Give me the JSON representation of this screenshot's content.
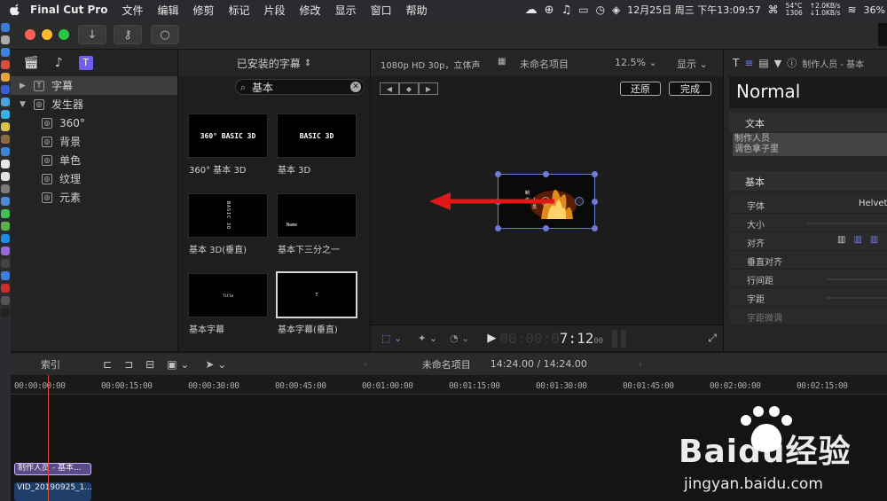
{
  "menubar": {
    "app": "Final Cut Pro",
    "menus": [
      "文件",
      "编辑",
      "修剪",
      "标记",
      "片段",
      "修改",
      "显示",
      "窗口",
      "帮助"
    ],
    "status": {
      "temp": "54°C",
      "fan": "1306",
      "up": "↑2.0KB/s",
      "down": "↓1.0KB/s",
      "datetime": "12月25日 周三 下午13:09:57",
      "battery": "36%"
    }
  },
  "library": {
    "items": [
      {
        "label": "字幕",
        "expanded": false,
        "selected": true
      },
      {
        "label": "发生器",
        "expanded": true,
        "selected": false
      }
    ],
    "generators": [
      "360°",
      "背景",
      "单色",
      "纹理",
      "元素"
    ]
  },
  "browser": {
    "header": "已安装的字幕",
    "search_value": "基本",
    "tiles": [
      {
        "thumb": "360° BASIC 3D",
        "caption": "360° 基本 3D"
      },
      {
        "thumb": "BASIC 3D",
        "caption": "基本 3D"
      },
      {
        "thumb": "BASIC 3D",
        "caption": "基本 3D(垂直)"
      },
      {
        "thumb": "Name",
        "caption": "基本下三分之一"
      },
      {
        "thumb": "Title",
        "caption": "基本字幕"
      },
      {
        "thumb": "T",
        "caption": "基本字幕(垂直)"
      }
    ]
  },
  "viewer": {
    "format": "1080p HD 30p，立体声",
    "project": "未命名项目",
    "zoom": "12.5%",
    "display_menu": "显示",
    "reset_button": "还原",
    "done_button": "完成",
    "timecode_dim": "00:00:0",
    "timecode_main": "7:12",
    "timecode_frames": "00"
  },
  "inspector": {
    "title": "制作人员 - 基本",
    "style_name": "Normal",
    "sections": {
      "text": "文本",
      "basic": "基本"
    },
    "text_value_line1": "制作人员",
    "text_value_line2": "调色拿子里",
    "params": [
      "字体",
      "大小",
      "对齐",
      "垂直对齐",
      "行间距",
      "字距",
      "字距微调"
    ],
    "font_value": "Helvet"
  },
  "timeline": {
    "index_label": "索引",
    "project": "未命名项目",
    "duration": "14:24.00 / 14:24.00",
    "ticks": [
      "00:00:00:00",
      "00:00:15:00",
      "00:00:30:00",
      "00:00:45:00",
      "00:01:00:00",
      "00:01:15:00",
      "00:01:30:00",
      "00:01:45:00",
      "00:02:00:00",
      "00:02:15:00"
    ],
    "title_clip": "制作人员 - 基本...",
    "video_clip": "VID_20190925_1..."
  },
  "watermark": {
    "brand": "Baidu经验",
    "url": "jingyan.baidu.com"
  },
  "colors": {
    "accent": "#6f5cf0",
    "playhead": "#e04a3a",
    "arrow": "#e01818"
  }
}
